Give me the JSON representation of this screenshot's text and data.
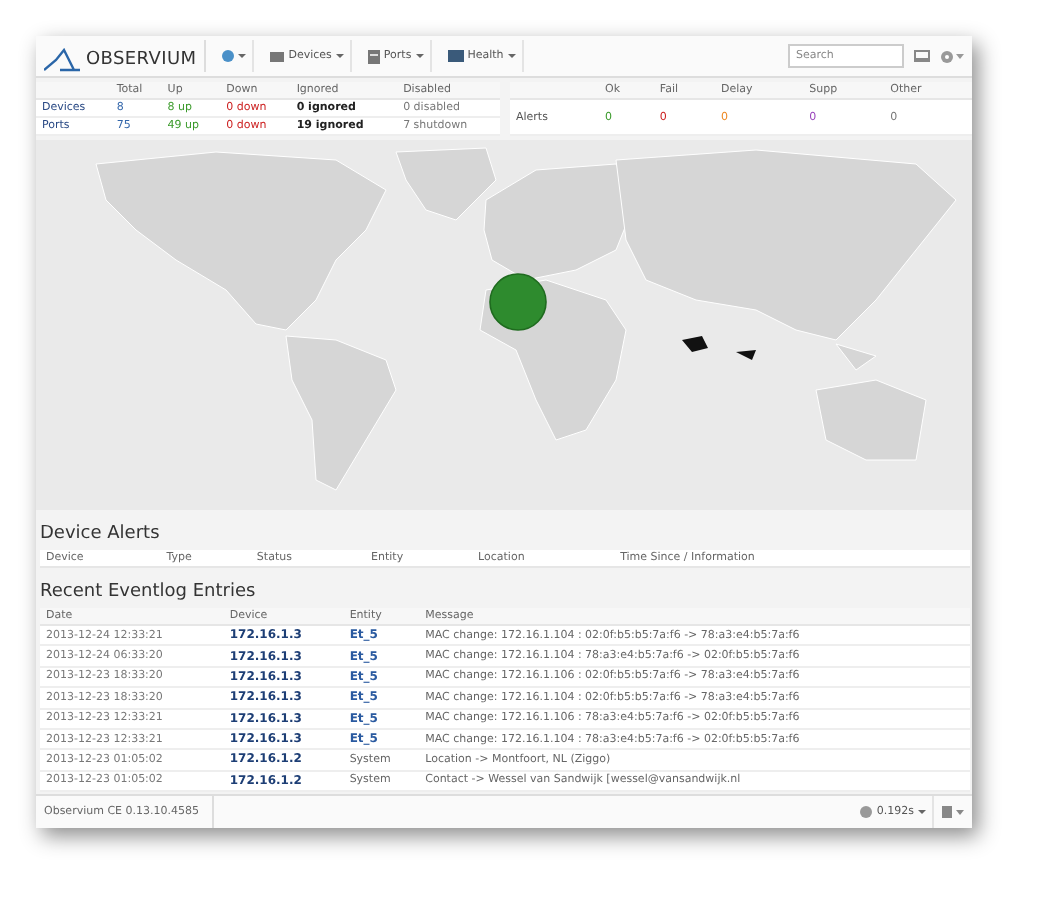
{
  "navbar": {
    "logo": "OBSERVIUM",
    "menus": [
      {
        "label": "Devices"
      },
      {
        "label": "Ports"
      },
      {
        "label": "Health"
      }
    ],
    "search": {
      "placeholder": "Search"
    }
  },
  "status_table": {
    "columns": [
      "Total",
      "Up",
      "Down",
      "Ignored",
      "Disabled"
    ],
    "rows": [
      {
        "label": "Devices",
        "cells": [
          "8",
          "8 up",
          "0 down",
          "0 ignored",
          "0 disabled"
        ]
      },
      {
        "label": "Ports",
        "cells": [
          "75",
          "49 up",
          "0 down",
          "19 ignored",
          "7 shutdown"
        ]
      }
    ]
  },
  "alerts_table": {
    "columns": [
      "Ok",
      "Fail",
      "Delay",
      "Supp",
      "Other"
    ],
    "rows": [
      {
        "label": "Alerts",
        "cells": [
          "0",
          "0",
          "0",
          "0",
          "0"
        ]
      }
    ]
  },
  "device_alerts": {
    "title": "Device Alerts",
    "columns": [
      "Device",
      "Type",
      "Status",
      "Entity",
      "Location",
      "Time Since / Information"
    ]
  },
  "eventlog": {
    "title": "Recent Eventlog Entries",
    "columns": [
      "Date",
      "Device",
      "Entity",
      "Message"
    ],
    "rows": [
      {
        "date": "2013-12-24 12:33:21",
        "device": "172.16.1.3",
        "entity": "Et_5",
        "kind": "port",
        "message": "MAC change: 172.16.1.104 : 02:0f:b5:b5:7a:f6 -> 78:a3:e4:b5:7a:f6"
      },
      {
        "date": "2013-12-24 06:33:20",
        "device": "172.16.1.3",
        "entity": "Et_5",
        "kind": "port",
        "message": "MAC change: 172.16.1.104 : 78:a3:e4:b5:7a:f6 -> 02:0f:b5:b5:7a:f6"
      },
      {
        "date": "2013-12-23 18:33:20",
        "device": "172.16.1.3",
        "entity": "Et_5",
        "kind": "port",
        "message": "MAC change: 172.16.1.106 : 02:0f:b5:b5:7a:f6 -> 78:a3:e4:b5:7a:f6"
      },
      {
        "date": "2013-12-23 18:33:20",
        "device": "172.16.1.3",
        "entity": "Et_5",
        "kind": "port",
        "message": "MAC change: 172.16.1.104 : 02:0f:b5:b5:7a:f6 -> 78:a3:e4:b5:7a:f6"
      },
      {
        "date": "2013-12-23 12:33:21",
        "device": "172.16.1.3",
        "entity": "Et_5",
        "kind": "port",
        "message": "MAC change: 172.16.1.106 : 78:a3:e4:b5:7a:f6 -> 02:0f:b5:b5:7a:f6"
      },
      {
        "date": "2013-12-23 12:33:21",
        "device": "172.16.1.3",
        "entity": "Et_5",
        "kind": "port",
        "message": "MAC change: 172.16.1.104 : 78:a3:e4:b5:7a:f6 -> 02:0f:b5:b5:7a:f6"
      },
      {
        "date": "2013-12-23 01:05:02",
        "device": "172.16.1.2",
        "entity": "System",
        "kind": "system",
        "message": "Location -> Montfoort, NL (Ziggo)"
      },
      {
        "date": "2013-12-23 01:05:02",
        "device": "172.16.1.2",
        "entity": "System",
        "kind": "system",
        "message": "Contact -> Wessel van Sandwijk [wessel@vansandwijk.nl"
      }
    ]
  },
  "footer": {
    "version": "Observium CE 0.13.10.4585",
    "timing": "0.192s"
  }
}
